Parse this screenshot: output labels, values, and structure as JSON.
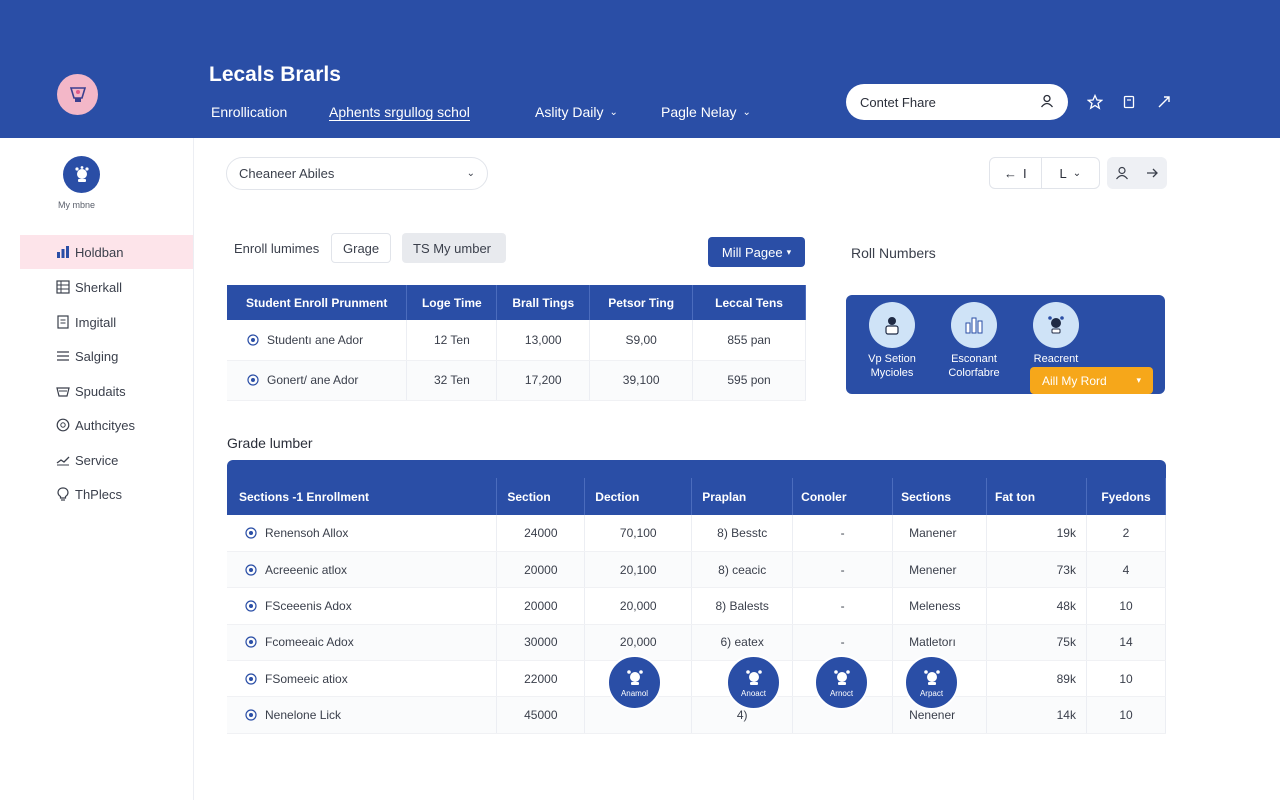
{
  "header": {
    "app_title": "Lecals Brarls",
    "nav": [
      {
        "label": "Enrollication"
      },
      {
        "label": "Aphents srgullog schol"
      },
      {
        "label": "Aslity Daily"
      },
      {
        "label": "Pagle Nelay"
      }
    ],
    "search_value": "Contet Fhare",
    "icons": [
      "logo-badge-icon",
      "person-icon",
      "star-icon",
      "bookmark-icon",
      "share-icon"
    ]
  },
  "sidebar": {
    "profile_label": "My mbne",
    "items": [
      {
        "label": "Holdban",
        "icon": "chart-icon"
      },
      {
        "label": "Sherkall",
        "icon": "grid-icon"
      },
      {
        "label": "Imgitall",
        "icon": "document-icon"
      },
      {
        "label": "Salging",
        "icon": "list-icon"
      },
      {
        "label": "Spudaits",
        "icon": "tray-icon"
      },
      {
        "label": "Authcityes",
        "icon": "circle-icon"
      },
      {
        "label": "Service",
        "icon": "hand-icon"
      },
      {
        "label": "ThPlecs",
        "icon": "bulb-icon"
      }
    ]
  },
  "toolbar": {
    "select_value": "Cheaneer Abiles",
    "pager": {
      "prev": "←",
      "page": "I",
      "mode": "L"
    }
  },
  "tabs": [
    {
      "label": "Enroll lumimes"
    },
    {
      "label": "Grage"
    },
    {
      "label": "TS My umber"
    }
  ],
  "mill_button": "Mill Pagee",
  "enroll_table": {
    "headers": [
      "Student Enroll Prunment",
      "Loge Time",
      "Brall Tings",
      "Petsor Ting",
      "Leccal Tens"
    ],
    "rows": [
      [
        "Studentı ane Ador",
        "12 Ten",
        "13,000",
        "S9,00",
        "855 pan"
      ],
      [
        "Gonert/ ane Ador",
        "32 Ten",
        "17,200",
        "39,100",
        "595 pon"
      ]
    ]
  },
  "grade_title": "Grade lumber",
  "grade_table": {
    "headers": [
      "Sections -1 Enrollment",
      "Section",
      "Dection",
      "Praplan",
      "Conoler",
      "Sections",
      "Fat ton",
      "Fyedons"
    ],
    "rows": [
      [
        "Renensoh Allox",
        "24000",
        "70,100",
        "8) Besstc",
        "-",
        "Manener",
        "19k",
        "2"
      ],
      [
        "Acreeenic atlox",
        "20000",
        "20,100",
        "8) ceacic",
        "-",
        "Menener",
        "73k",
        "4"
      ],
      [
        "FSceeenis Adox",
        "20000",
        "20,000",
        "8) Balests",
        "-",
        "Meleness",
        "48k",
        "10"
      ],
      [
        "Fcomeeaic Adox",
        "30000",
        "20,000",
        "6) eatex",
        "-",
        "Matletorı",
        "75k",
        "14"
      ],
      [
        "FSomeeic atiox",
        "22000",
        "",
        "",
        "",
        "",
        "89k",
        "10"
      ],
      [
        "Nenelone Lick",
        "45000",
        "",
        "4)",
        "",
        "Nenener",
        "14k",
        "10"
      ]
    ]
  },
  "roll": {
    "title": "Roll Numbers",
    "items": [
      {
        "line1": "Vp Setion",
        "line2": "Mycioles"
      },
      {
        "line1": "Esconant",
        "line2": "Colorfabre"
      },
      {
        "line1": "Reacrent",
        "line2": ""
      }
    ],
    "add_button": "Aill My Rord"
  },
  "floating_badges": [
    {
      "label": "Anamol"
    },
    {
      "label": "Anoact"
    },
    {
      "label": "Arnoct"
    },
    {
      "label": "Arpact"
    }
  ]
}
